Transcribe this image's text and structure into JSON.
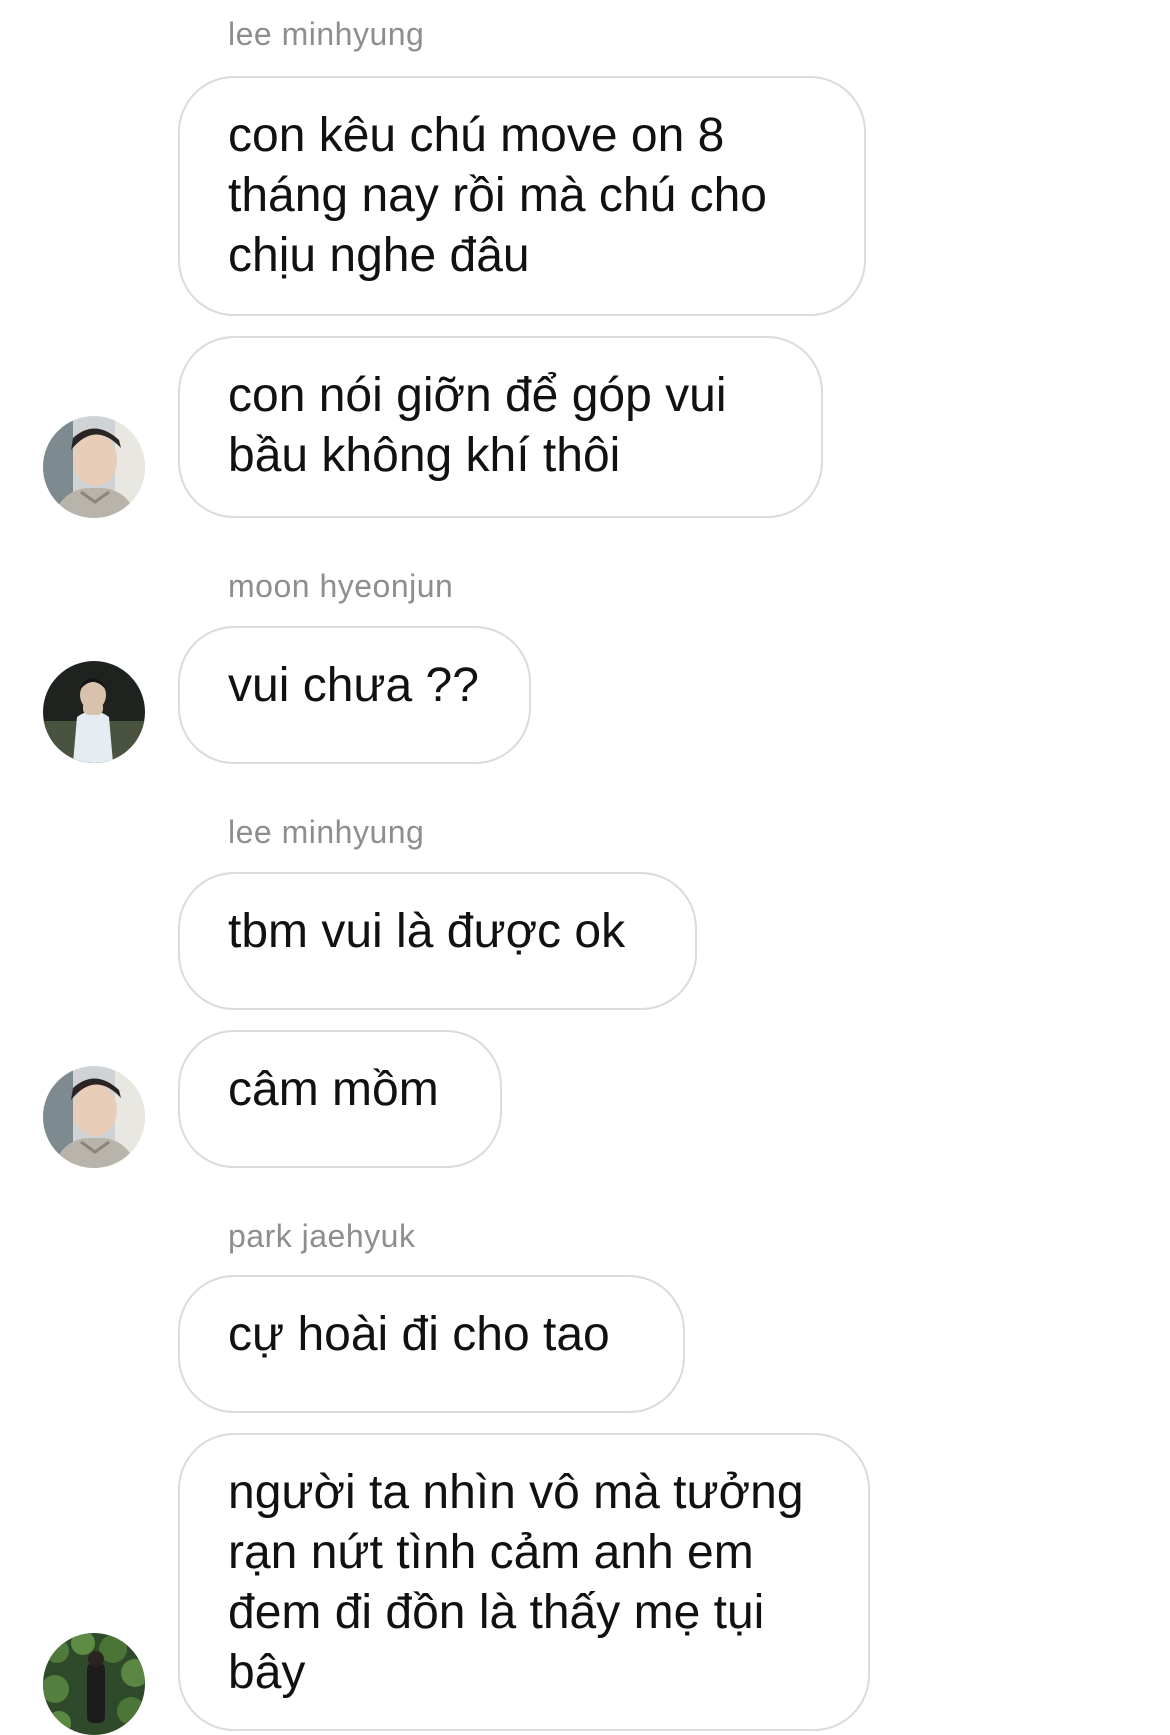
{
  "thread": {
    "messages": [
      {
        "sender": "lee minhyung",
        "text": "con kêu chú move on 8 tháng nay rồi mà chú cho chịu nghe đâu"
      },
      {
        "text": "con nói giỡn để góp vui bầu không khí thôi"
      },
      {
        "sender": "moon hyeonjun",
        "text": "vui chưa ??"
      },
      {
        "sender": "lee minhyung",
        "text": "tbm vui là được ok"
      },
      {
        "text": "câm mồm"
      },
      {
        "sender": "park jaehyuk",
        "text": "cự hoài đi cho tao"
      },
      {
        "text": "người ta nhìn vô mà tưởng rạn nứt tình cảm anh em đem đi đồn là thấy mẹ tụi bây"
      }
    ]
  },
  "colors": {
    "sender_label": "#8e8e8e",
    "bubble_border": "#dbdbdb",
    "message_text": "#111111"
  },
  "icons": [
    "avatar-lee-minhyung",
    "avatar-moon-hyeonjun",
    "avatar-park-jaehyuk"
  ]
}
